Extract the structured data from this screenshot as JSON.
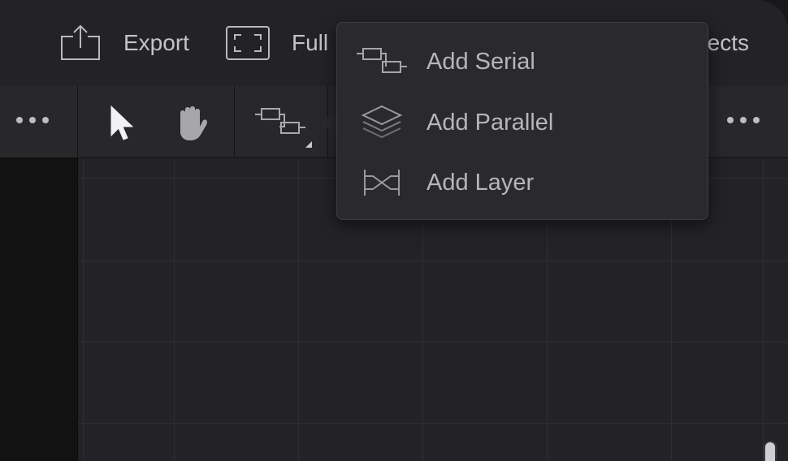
{
  "header": {
    "export_label": "Export",
    "fullscreen_label": "Full",
    "right_label": "ects",
    "export_icon": "export-icon",
    "fullscreen_icon": "fullscreen-icon"
  },
  "toolbar": {
    "left_more_icon": "more-icon",
    "pointer_icon": "pointer-icon",
    "hand_icon": "hand-icon",
    "routing_icon": "serial-routing-icon",
    "right_more_icon": "more-icon"
  },
  "routing_menu": {
    "items": [
      {
        "label": "Add Serial",
        "icon": "serial-icon"
      },
      {
        "label": "Add Parallel",
        "icon": "parallel-layers-icon"
      },
      {
        "label": "Add Layer",
        "icon": "layer-crossing-icon"
      }
    ]
  },
  "colors": {
    "header_bg": "#232326",
    "toolbar_bg": "#28282b",
    "canvas_bg": "#232327",
    "menu_bg": "#2a2a2e",
    "text": "#c4c4c8"
  }
}
